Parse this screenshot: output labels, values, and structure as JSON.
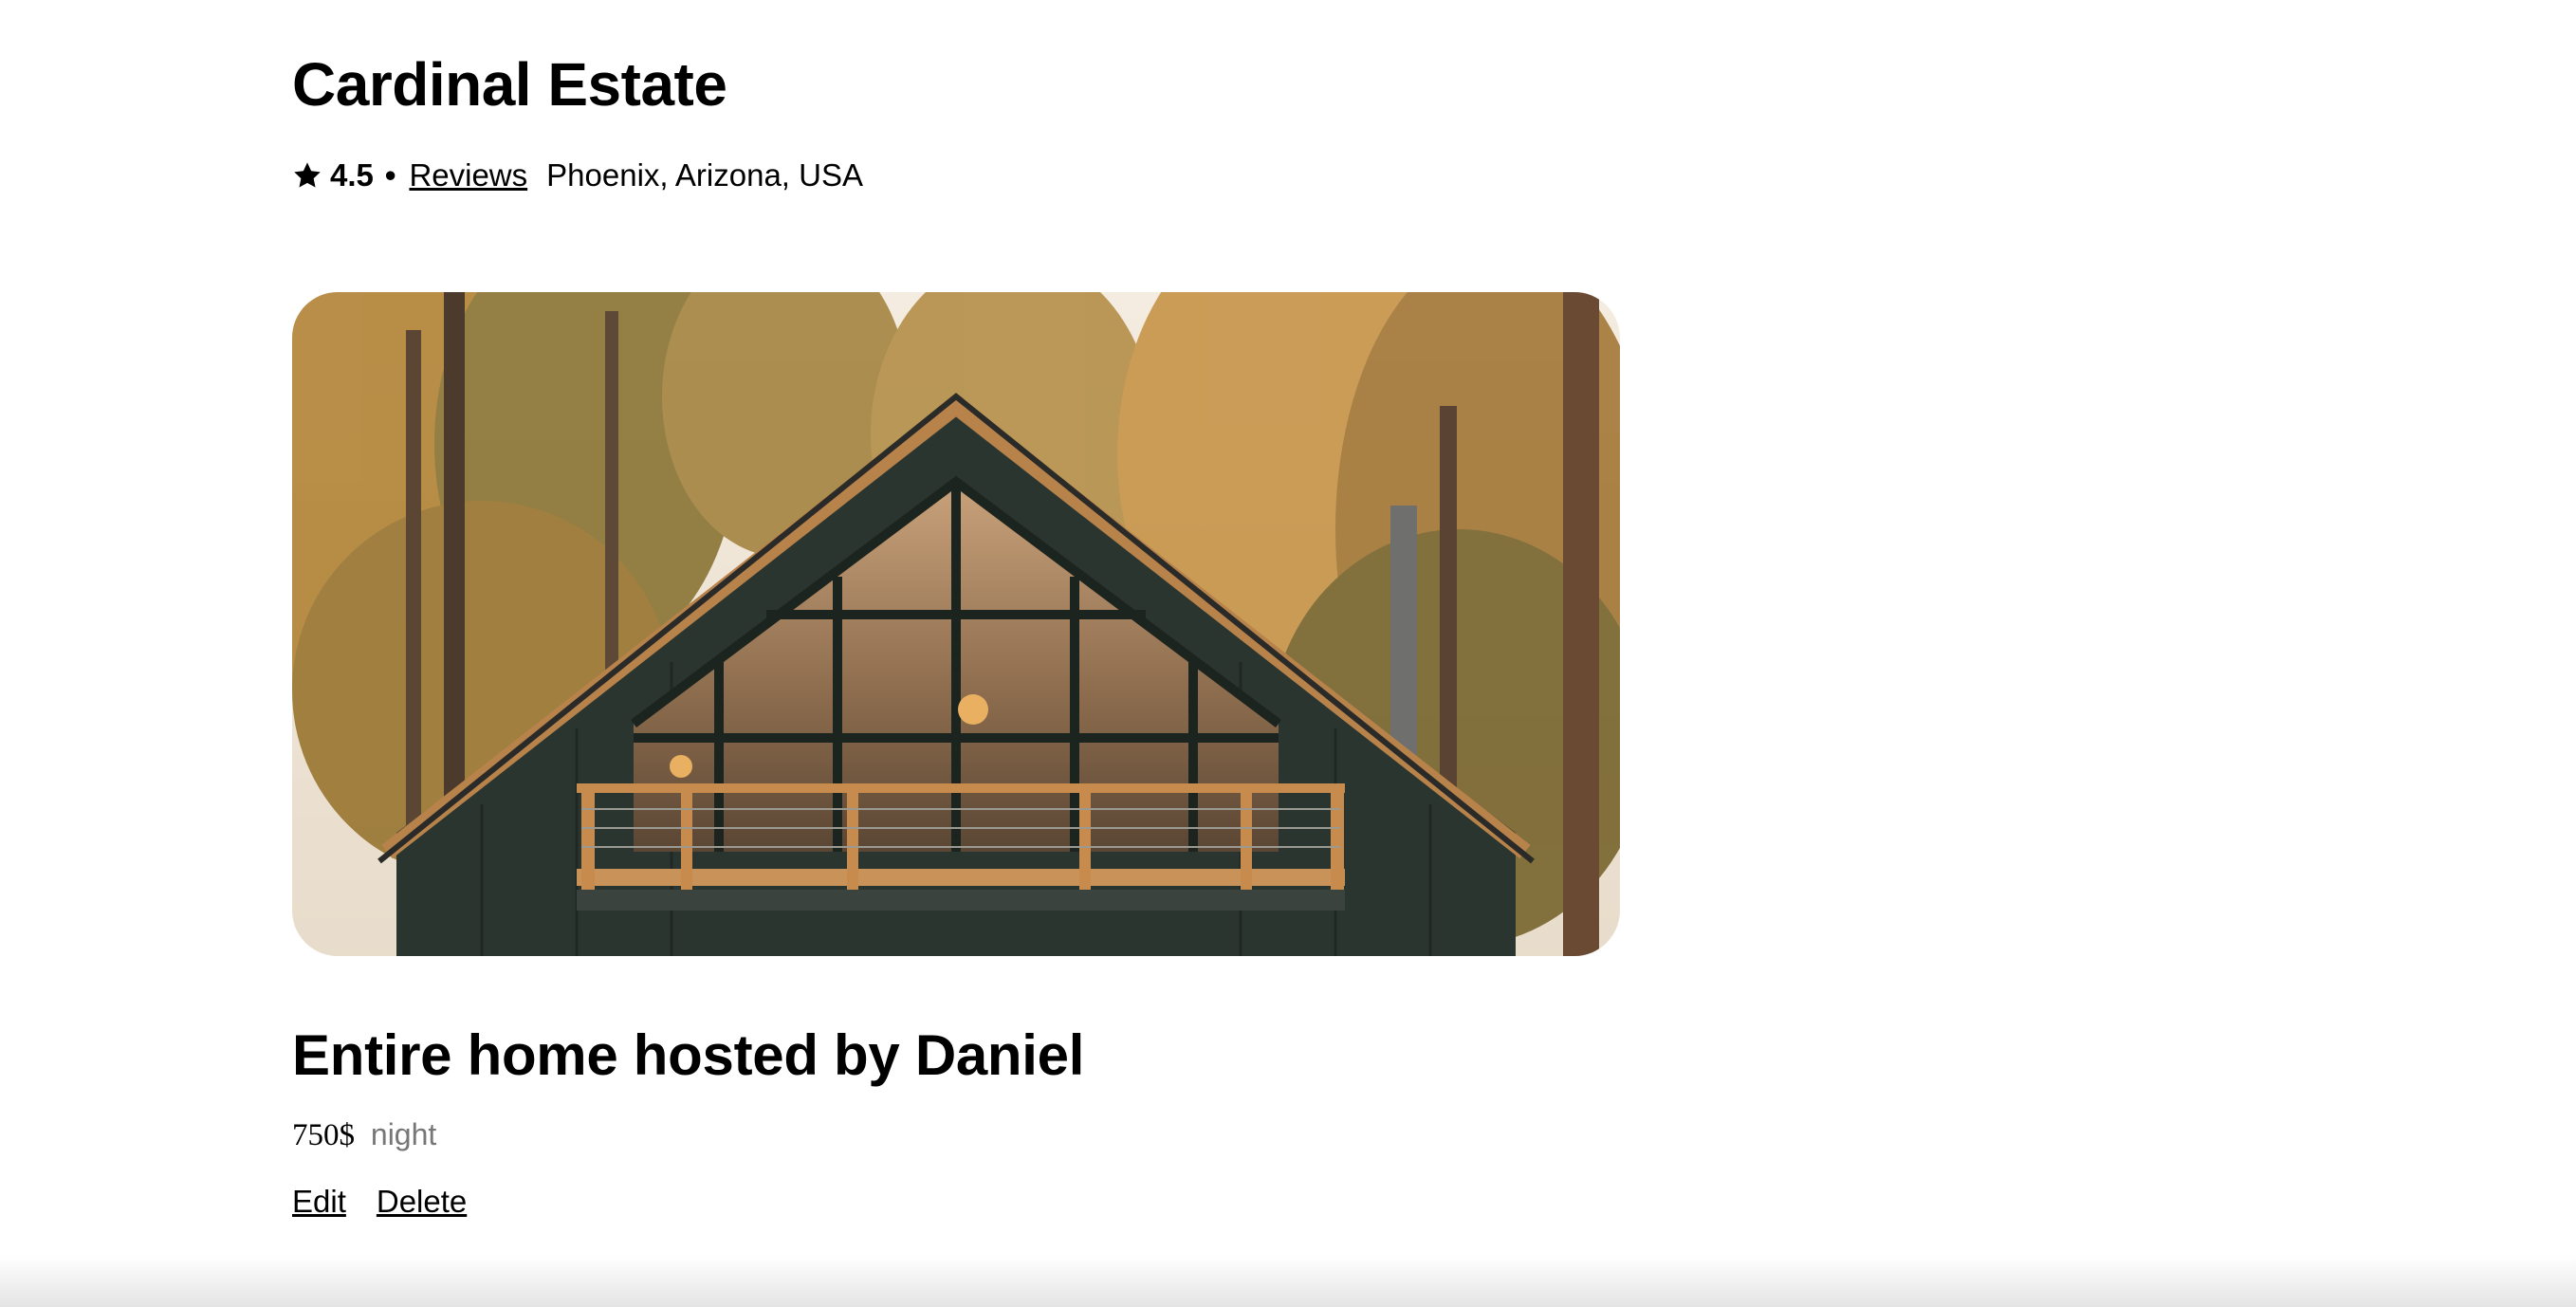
{
  "listing": {
    "title": "Cardinal Estate",
    "rating": "4.5",
    "separator": "•",
    "reviews_label": "Reviews",
    "location": "Phoenix, Arizona, USA",
    "photo_icon": "a-frame-cabin-photo",
    "subtitle": "Entire home hosted by Daniel",
    "price": "750$",
    "price_unit": "night"
  },
  "actions": {
    "edit_label": "Edit",
    "delete_label": "Delete"
  },
  "colors": {
    "text": "#000000",
    "muted": "#777777",
    "background": "#ffffff"
  }
}
